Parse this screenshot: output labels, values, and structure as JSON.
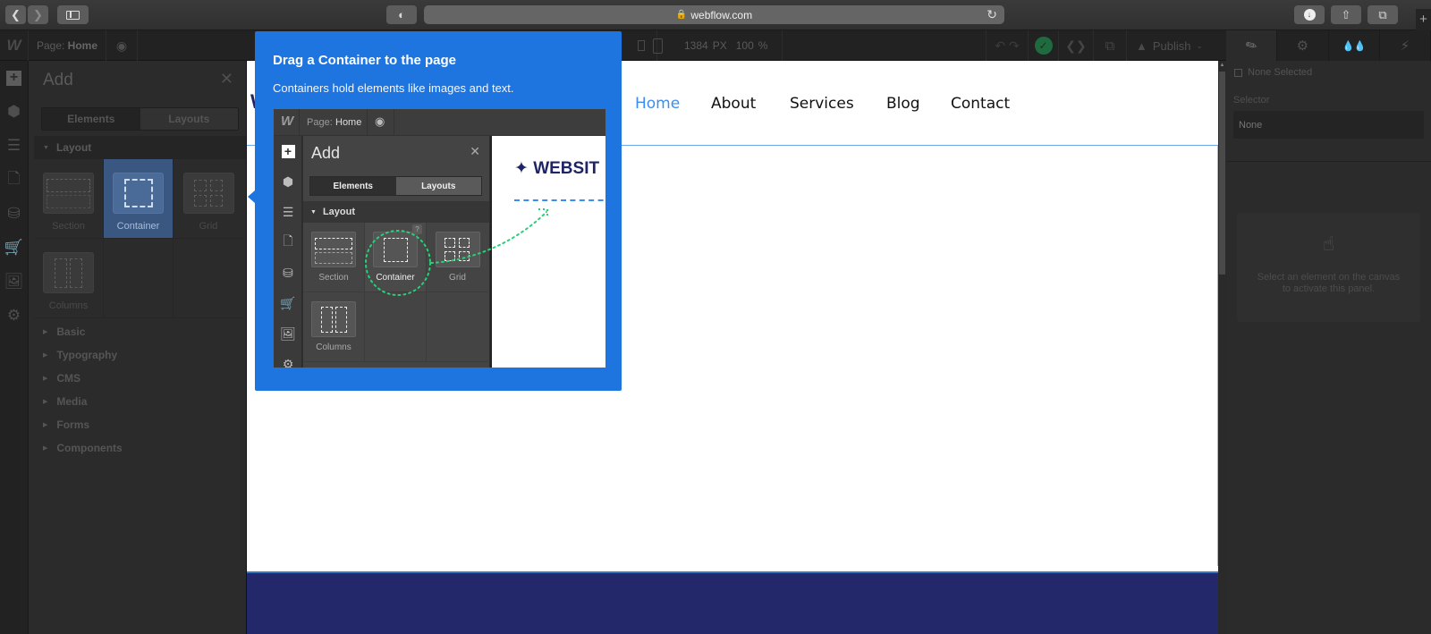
{
  "browser": {
    "url": "webflow.com",
    "new_tab_label": "+"
  },
  "topbar": {
    "page_label": "Page:",
    "page_name": "Home",
    "canvas_width": "1384",
    "canvas_width_unit": "PX",
    "zoom": "100",
    "zoom_unit": "%",
    "publish_label": "Publish"
  },
  "add_panel": {
    "title": "Add",
    "tabs": [
      {
        "label": "Elements",
        "active": true
      },
      {
        "label": "Layouts",
        "active": false
      }
    ],
    "layout_section": "Layout",
    "layout_items": [
      {
        "label": "Section",
        "selected": false
      },
      {
        "label": "Container",
        "selected": true
      },
      {
        "label": "Grid",
        "selected": false
      },
      {
        "label": "Columns",
        "selected": false
      }
    ],
    "categories": [
      "Basic",
      "Typography",
      "CMS",
      "Media",
      "Forms",
      "Components"
    ]
  },
  "canvas": {
    "nav_links": [
      {
        "label": "Home",
        "active": true
      },
      {
        "label": "About",
        "active": false
      },
      {
        "label": "Services",
        "active": false
      },
      {
        "label": "Blog",
        "active": false
      },
      {
        "label": "Contact",
        "active": false
      }
    ],
    "brand_partial": "W",
    "colors": {
      "nav_active": "#3b8ef0",
      "footer_band": "#23286a",
      "selection_outline": "#6ea6ee"
    }
  },
  "right_panel": {
    "tabs": [
      "style",
      "settings",
      "interactions-drops",
      "lightning"
    ],
    "none_selected_label": "None Selected",
    "selector_label": "Selector",
    "selector_placeholder": "None",
    "empty_message": "Select an element on the canvas to activate this panel."
  },
  "tooltip": {
    "title": "Drag a Container to the page",
    "description": "Containers hold elements like images and text.",
    "accent_color": "#1f75e0",
    "demo": {
      "page_label": "Page:",
      "page_name": "Home",
      "panel_title": "Add",
      "tabs": [
        "Elements",
        "Layouts"
      ],
      "section": "Layout",
      "items": [
        "Section",
        "Container",
        "Grid",
        "Columns"
      ],
      "help_badge": "?",
      "site_brand": "WEBSIT"
    }
  }
}
